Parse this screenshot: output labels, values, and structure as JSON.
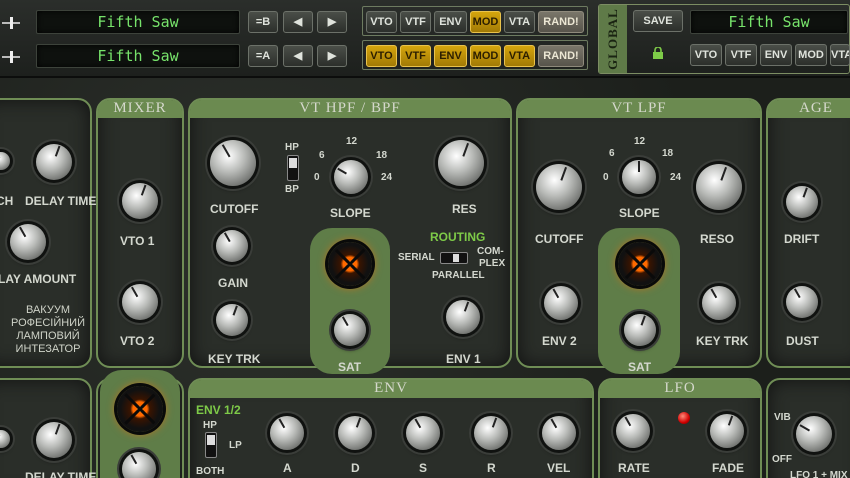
{
  "top": {
    "row1": {
      "patch": "Fifth Saw",
      "ab": "=B",
      "buttons": [
        "VTO",
        "VTF",
        "ENV",
        "MOD",
        "VTA",
        "RAND!"
      ],
      "active": [
        "MOD"
      ]
    },
    "row2": {
      "patch": "Fifth Saw",
      "ab": "=A",
      "buttons": [
        "VTO",
        "VTF",
        "ENV",
        "MOD",
        "VTA",
        "RAND!"
      ],
      "active": [
        "VTO",
        "VTF",
        "ENV",
        "MOD",
        "VTA"
      ]
    },
    "prev_icon": "triangle-left-icon",
    "next_icon": "triangle-right-icon"
  },
  "global": {
    "label": "GLOBAL",
    "save": "SAVE",
    "patch": "Fifth Saw",
    "buttons": [
      "VTO",
      "VTF",
      "ENV",
      "MOD",
      "VTA"
    ],
    "lock_icon": "lock-icon"
  },
  "delay": {
    "time": "DELAY TIME",
    "amount": "LAY AMOUNT",
    "ch": "CH",
    "cyrillic": [
      "ВАКУУМ",
      "РОФЕСІЙНИЙ",
      "ЛАМПОВИЙ",
      "ИНТЕЗАТОР"
    ]
  },
  "mixer": {
    "title": "MIXER",
    "vto1": "VTO 1",
    "vto2": "VTO 2"
  },
  "hpf": {
    "title": "VT HPF / BPF",
    "cutoff": "CUTOFF",
    "gain": "GAIN",
    "keytrk": "KEY TRK",
    "slope": "SLOPE",
    "res": "RES",
    "sat": "SAT",
    "env1": "ENV 1",
    "hp": "HP",
    "bp": "BP",
    "ticks": [
      "6",
      "12",
      "18",
      "0",
      "24"
    ],
    "routing": "ROUTING",
    "serial": "SERIAL",
    "complex": "COM-",
    "complex2": "PLEX",
    "parallel": "PARALLEL"
  },
  "lpf": {
    "title": "VT LPF",
    "cutoff": "CUTOFF",
    "slope": "SLOPE",
    "reso": "RESO",
    "env2": "ENV 2",
    "sat": "SAT",
    "keytrk": "KEY TRK",
    "ticks": [
      "6",
      "12",
      "18",
      "0",
      "24"
    ]
  },
  "age": {
    "title": "AGE",
    "drift": "DRIFT",
    "dust": "DUST"
  },
  "env": {
    "title": "ENV",
    "sub": "ENV 1/2",
    "hp": "HP",
    "lp": "LP",
    "both": "BOTH",
    "knobs": [
      "A",
      "D",
      "S",
      "R",
      "VEL"
    ]
  },
  "lfo": {
    "title": "LFO",
    "rate": "RATE",
    "fade": "FADE"
  },
  "vib": {
    "vib": "VIB",
    "off": "OFF",
    "lfo": "LFO 1 + MIX"
  },
  "colors": {
    "accent_green": "#6b8a50",
    "lcd_text": "#77e36b",
    "active_button": "#d5a50d",
    "tube_glow": "#ff6a00"
  }
}
